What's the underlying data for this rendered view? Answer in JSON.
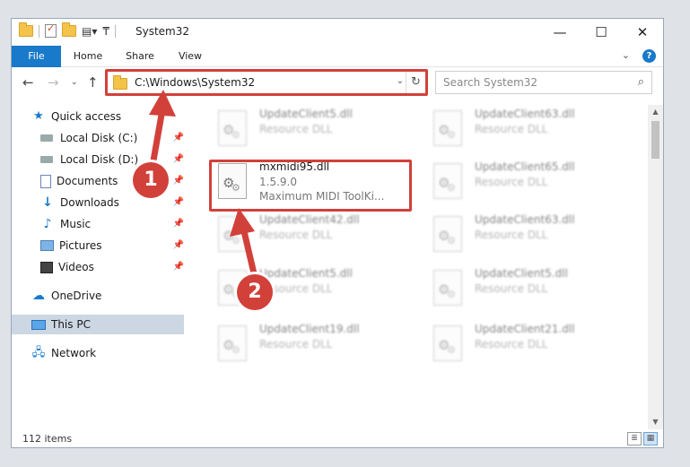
{
  "window": {
    "title": "System32",
    "controls": {
      "minimize": "—",
      "maximize": "☐",
      "close": "✕"
    }
  },
  "ribbon": {
    "tabs": [
      "File",
      "Home",
      "Share",
      "View"
    ],
    "expand_icon": "chevron-down-icon",
    "help": "?"
  },
  "nav": {
    "address": "C:\\Windows\\System32",
    "search_placeholder": "Search System32"
  },
  "sidebar": {
    "items": [
      {
        "label": "Quick access",
        "icon": "star-icon",
        "pinned": false
      },
      {
        "label": "Local Disk (C:)",
        "icon": "drive-icon",
        "pinned": true
      },
      {
        "label": "Local Disk (D:)",
        "icon": "drive-icon",
        "pinned": true
      },
      {
        "label": "Documents",
        "icon": "documents-icon",
        "pinned": true
      },
      {
        "label": "Downloads",
        "icon": "downloads-icon",
        "pinned": true
      },
      {
        "label": "Music",
        "icon": "music-icon",
        "pinned": true
      },
      {
        "label": "Pictures",
        "icon": "pictures-icon",
        "pinned": true
      },
      {
        "label": "Videos",
        "icon": "videos-icon",
        "pinned": true
      },
      {
        "label": "OneDrive",
        "icon": "onedrive-icon",
        "pinned": false
      },
      {
        "label": "This PC",
        "icon": "pc-icon",
        "pinned": false,
        "selected": true
      },
      {
        "label": "Network",
        "icon": "network-icon",
        "pinned": false
      }
    ]
  },
  "files": {
    "selected": {
      "name": "mxmidi95.dll",
      "version": "1.5.9.0",
      "description": "Maximum MIDI ToolKi..."
    },
    "others": [
      {
        "name": "UpdateClient5.dll",
        "type": "Resource DLL"
      },
      {
        "name": "UpdateClient63.dll",
        "type": "Resource DLL"
      },
      {
        "name": "UpdateClient65.dll",
        "type": "Resource DLL"
      },
      {
        "name": "UpdateClient42.dll",
        "type": "Resource DLL"
      },
      {
        "name": "UpdateClient63.dll",
        "type": "Resource DLL"
      },
      {
        "name": "UpdateClient5.dll",
        "type": "Resource DLL"
      },
      {
        "name": "UpdateClient5.dll",
        "type": "Resource DLL"
      },
      {
        "name": "UpdateClient19.dll",
        "type": "Resource DLL"
      },
      {
        "name": "UpdateClient21.dll",
        "type": "Resource DLL"
      }
    ]
  },
  "status": {
    "item_count": "112 items"
  },
  "annotations": {
    "step1": "1",
    "step2": "2",
    "color": "#d2403a"
  }
}
